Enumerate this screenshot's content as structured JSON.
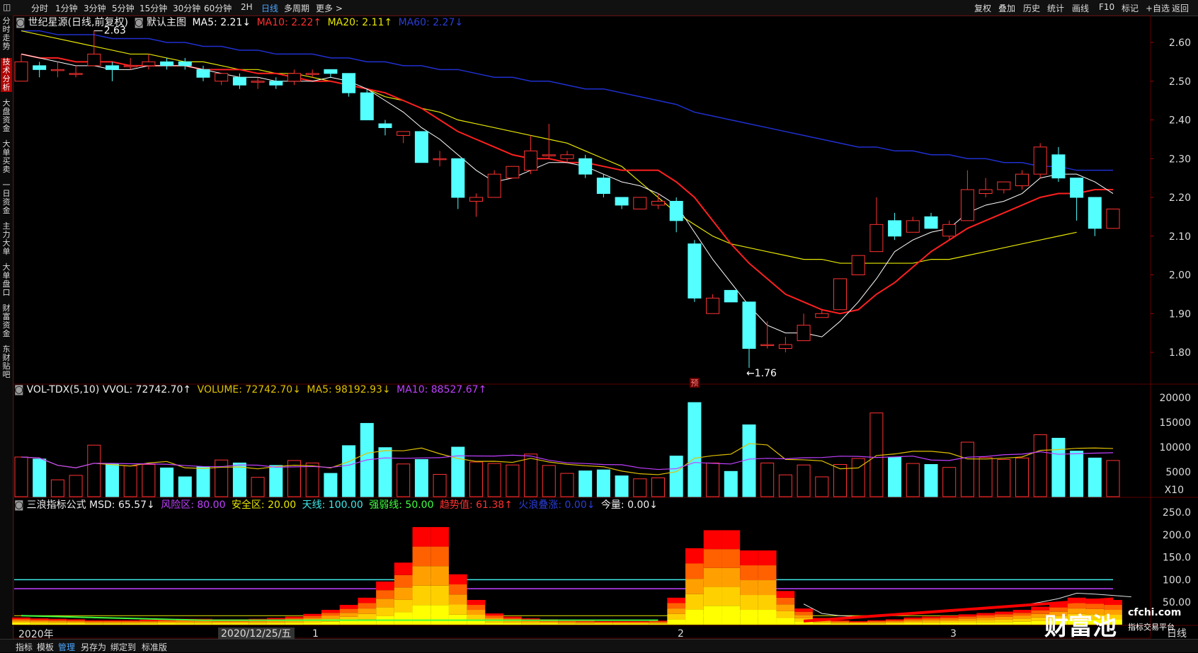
{
  "topbar": {
    "left_tabs": [
      "分时",
      "1分钟",
      "3分钟",
      "5分钟",
      "15分钟",
      "30分钟",
      "60分钟",
      "2H",
      "日线",
      "多周期",
      "更多 >"
    ],
    "active_tab": 8,
    "right_tabs": [
      "复权",
      "叠加",
      "历史",
      "统计",
      "画线",
      "F10",
      "标记",
      "+自选",
      "返回"
    ]
  },
  "sidebar": {
    "items": [
      "分时走势",
      "技术分析",
      "大盘资金",
      "大单买卖",
      "一日资金",
      "主力大单",
      "大单盘口",
      "财富资金",
      "东财贴吧"
    ],
    "active": 1
  },
  "main_legend": {
    "stock": "世纪星源(日线,前复权)",
    "chart_name": "默认主图",
    "ma5": "MA5: 2.21↓",
    "ma10": "MA10: 2.22↑",
    "ma20": "MA20: 2.11↑",
    "ma60": "MA60: 2.27↓"
  },
  "vol_legend": {
    "name": "VOL-TDX(5,10) VVOL: 72742.70↑",
    "volume": "VOLUME: 72742.70↓",
    "ma5": "MA5: 98192.93↓",
    "ma10": "MA10: 88527.67↑"
  },
  "ind_legend": {
    "name": "三浪指标公式 MSD: 65.57↓",
    "risk": "风险区: 80.00",
    "safe": "安全区: 20.00",
    "sky": "天线: 100.00",
    "strong": "强弱线: 50.00",
    "trend": "趋势值: 61.38↑",
    "wave": "火浪叠涨: 0.00↓",
    "today": "今量: 0.00↓"
  },
  "annotations": {
    "high": "2.63",
    "low": "←1.76",
    "forecast": "预"
  },
  "price_axis": [
    "2.60",
    "2.50",
    "2.40",
    "2.30",
    "2.20",
    "2.10",
    "2.00",
    "1.90",
    "1.80"
  ],
  "vol_axis": [
    "20000",
    "15000",
    "10000",
    "5000",
    "X10"
  ],
  "ind_axis": [
    "250.0",
    "200.0",
    "150.0",
    "100.0",
    "50.00"
  ],
  "date_axis": {
    "year": "2020年",
    "date": "2020/12/25/五",
    "months": [
      "1",
      "2",
      "3"
    ],
    "period": "日线"
  },
  "bottombar": {
    "items": [
      "指标",
      "模板",
      "管理",
      "另存为",
      "绑定到",
      "标准版"
    ],
    "active": 2
  },
  "watermark": {
    "brand": "财富池",
    "site": "cfchi.com",
    "tagline": "指标交易平台"
  },
  "colors": {
    "up": "#ff3232",
    "down": "#54ffff",
    "ma5": "#ffffff",
    "ma10": "#ff2020",
    "ma20": "#e8e800",
    "ma60": "#2030d0",
    "vol_ma5": "#e0c000",
    "vol_ma10": "#c040ff"
  },
  "chart_data": {
    "type": "candlestick",
    "price_range": [
      1.76,
      2.63
    ],
    "candles": [
      {
        "o": 2.5,
        "h": 2.57,
        "l": 2.5,
        "c": 2.55
      },
      {
        "o": 2.54,
        "h": 2.55,
        "l": 2.51,
        "c": 2.53
      },
      {
        "o": 2.53,
        "h": 2.55,
        "l": 2.51,
        "c": 2.53
      },
      {
        "o": 2.52,
        "h": 2.54,
        "l": 2.51,
        "c": 2.52
      },
      {
        "o": 2.54,
        "h": 2.63,
        "l": 2.54,
        "c": 2.57
      },
      {
        "o": 2.54,
        "h": 2.55,
        "l": 2.5,
        "c": 2.53
      },
      {
        "o": 2.54,
        "h": 2.56,
        "l": 2.53,
        "c": 2.54
      },
      {
        "o": 2.54,
        "h": 2.57,
        "l": 2.53,
        "c": 2.55
      },
      {
        "o": 2.55,
        "h": 2.56,
        "l": 2.53,
        "c": 2.54
      },
      {
        "o": 2.55,
        "h": 2.56,
        "l": 2.53,
        "c": 2.54
      },
      {
        "o": 2.53,
        "h": 2.54,
        "l": 2.5,
        "c": 2.51
      },
      {
        "o": 2.5,
        "h": 2.52,
        "l": 2.49,
        "c": 2.52
      },
      {
        "o": 2.51,
        "h": 2.52,
        "l": 2.48,
        "c": 2.49
      },
      {
        "o": 2.5,
        "h": 2.51,
        "l": 2.48,
        "c": 2.5
      },
      {
        "o": 2.5,
        "h": 2.51,
        "l": 2.48,
        "c": 2.49
      },
      {
        "o": 2.5,
        "h": 2.53,
        "l": 2.49,
        "c": 2.52
      },
      {
        "o": 2.52,
        "h": 2.53,
        "l": 2.51,
        "c": 2.52
      },
      {
        "o": 2.53,
        "h": 2.53,
        "l": 2.51,
        "c": 2.52
      },
      {
        "o": 2.52,
        "h": 2.52,
        "l": 2.46,
        "c": 2.47
      },
      {
        "o": 2.47,
        "h": 2.48,
        "l": 2.4,
        "c": 2.4
      },
      {
        "o": 2.39,
        "h": 2.4,
        "l": 2.36,
        "c": 2.38
      },
      {
        "o": 2.36,
        "h": 2.37,
        "l": 2.34,
        "c": 2.37
      },
      {
        "o": 2.37,
        "h": 2.37,
        "l": 2.29,
        "c": 2.29
      },
      {
        "o": 2.3,
        "h": 2.32,
        "l": 2.28,
        "c": 2.3
      },
      {
        "o": 2.3,
        "h": 2.3,
        "l": 2.17,
        "c": 2.2
      },
      {
        "o": 2.19,
        "h": 2.21,
        "l": 2.15,
        "c": 2.2
      },
      {
        "o": 2.2,
        "h": 2.27,
        "l": 2.2,
        "c": 2.26
      },
      {
        "o": 2.25,
        "h": 2.28,
        "l": 2.25,
        "c": 2.28
      },
      {
        "o": 2.27,
        "h": 2.36,
        "l": 2.26,
        "c": 2.32
      },
      {
        "o": 2.31,
        "h": 2.39,
        "l": 2.3,
        "c": 2.31
      },
      {
        "o": 2.3,
        "h": 2.32,
        "l": 2.29,
        "c": 2.31
      },
      {
        "o": 2.3,
        "h": 2.31,
        "l": 2.25,
        "c": 2.26
      },
      {
        "o": 2.25,
        "h": 2.26,
        "l": 2.2,
        "c": 2.21
      },
      {
        "o": 2.2,
        "h": 2.2,
        "l": 2.17,
        "c": 2.18
      },
      {
        "o": 2.17,
        "h": 2.2,
        "l": 2.17,
        "c": 2.2
      },
      {
        "o": 2.18,
        "h": 2.21,
        "l": 2.17,
        "c": 2.19
      },
      {
        "o": 2.19,
        "h": 2.2,
        "l": 2.11,
        "c": 2.14
      },
      {
        "o": 2.08,
        "h": 2.09,
        "l": 1.93,
        "c": 1.94
      },
      {
        "o": 1.9,
        "h": 1.95,
        "l": 1.9,
        "c": 1.94
      },
      {
        "o": 1.96,
        "h": 1.96,
        "l": 1.93,
        "c": 1.93
      },
      {
        "o": 1.93,
        "h": 1.93,
        "l": 1.76,
        "c": 1.81
      },
      {
        "o": 1.82,
        "h": 1.88,
        "l": 1.81,
        "c": 1.82
      },
      {
        "o": 1.81,
        "h": 1.84,
        "l": 1.8,
        "c": 1.82
      },
      {
        "o": 1.83,
        "h": 1.9,
        "l": 1.83,
        "c": 1.87
      },
      {
        "o": 1.89,
        "h": 1.91,
        "l": 1.89,
        "c": 1.9
      },
      {
        "o": 1.91,
        "h": 1.99,
        "l": 1.91,
        "c": 1.99
      },
      {
        "o": 2.0,
        "h": 2.05,
        "l": 2.0,
        "c": 2.05
      },
      {
        "o": 2.06,
        "h": 2.2,
        "l": 2.06,
        "c": 2.13
      },
      {
        "o": 2.14,
        "h": 2.16,
        "l": 2.09,
        "c": 2.1
      },
      {
        "o": 2.11,
        "h": 2.15,
        "l": 2.11,
        "c": 2.14
      },
      {
        "o": 2.15,
        "h": 2.16,
        "l": 2.12,
        "c": 2.12
      },
      {
        "o": 2.1,
        "h": 2.14,
        "l": 2.09,
        "c": 2.13
      },
      {
        "o": 2.14,
        "h": 2.27,
        "l": 2.14,
        "c": 2.22
      },
      {
        "o": 2.21,
        "h": 2.25,
        "l": 2.2,
        "c": 2.22
      },
      {
        "o": 2.22,
        "h": 2.24,
        "l": 2.21,
        "c": 2.24
      },
      {
        "o": 2.23,
        "h": 2.27,
        "l": 2.22,
        "c": 2.26
      },
      {
        "o": 2.26,
        "h": 2.34,
        "l": 2.25,
        "c": 2.33
      },
      {
        "o": 2.31,
        "h": 2.33,
        "l": 2.24,
        "c": 2.25
      },
      {
        "o": 2.25,
        "h": 2.25,
        "l": 2.14,
        "c": 2.2
      },
      {
        "o": 2.2,
        "h": 2.2,
        "l": 2.1,
        "c": 2.12
      },
      {
        "o": 2.12,
        "h": 2.17,
        "l": 2.12,
        "c": 2.17
      }
    ],
    "volume": [
      8000,
      7600,
      3400,
      4300,
      10400,
      6600,
      6200,
      6500,
      5800,
      4000,
      6000,
      7400,
      6800,
      3900,
      6300,
      7300,
      6800,
      4700,
      10300,
      14800,
      9900,
      6600,
      7500,
      4500,
      10000,
      7000,
      6700,
      6400,
      8600,
      6300,
      4700,
      5200,
      5400,
      4200,
      3600,
      3800,
      8200,
      19000,
      6800,
      5100,
      14500,
      6800,
      4400,
      6400,
      4000,
      6500,
      7700,
      16900,
      8000,
      6700,
      6500,
      5900,
      11000,
      7900,
      7500,
      7800,
      12500,
      11800,
      9200,
      7800,
      7300
    ],
    "msd_series": [
      16,
      14,
      13,
      12,
      10,
      10,
      10,
      11,
      12,
      13,
      13,
      12,
      12,
      13,
      15,
      18,
      24,
      33,
      44,
      60,
      96,
      138,
      217,
      217,
      112,
      55,
      25,
      18,
      14,
      12,
      10,
      9,
      8,
      8,
      8,
      9,
      60,
      170,
      210,
      210,
      165,
      165,
      75,
      36,
      15,
      10,
      8,
      10,
      12,
      16,
      18,
      20,
      23,
      26,
      29,
      33,
      40,
      48,
      60,
      58,
      55,
      52
    ],
    "ma5": [
      2.57,
      2.56,
      2.55,
      2.54,
      2.54,
      2.53,
      2.53,
      2.54,
      2.54,
      2.54,
      2.53,
      2.52,
      2.51,
      2.51,
      2.5,
      2.5,
      2.5,
      2.51,
      2.5,
      2.48,
      2.45,
      2.42,
      2.38,
      2.35,
      2.31,
      2.27,
      2.24,
      2.25,
      2.27,
      2.29,
      2.29,
      2.28,
      2.26,
      2.24,
      2.23,
      2.21,
      2.18,
      2.11,
      2.04,
      1.98,
      1.92,
      1.87,
      1.85,
      1.85,
      1.84,
      1.88,
      1.93,
      1.99,
      2.06,
      2.09,
      2.11,
      2.12,
      2.16,
      2.18,
      2.19,
      2.21,
      2.25,
      2.26,
      2.26,
      2.24,
      2.21
    ],
    "ma10": [
      2.57,
      2.56,
      2.56,
      2.55,
      2.55,
      2.55,
      2.54,
      2.54,
      2.54,
      2.54,
      2.53,
      2.53,
      2.53,
      2.52,
      2.52,
      2.51,
      2.5,
      2.5,
      2.49,
      2.48,
      2.47,
      2.45,
      2.43,
      2.4,
      2.37,
      2.35,
      2.33,
      2.31,
      2.3,
      2.3,
      2.29,
      2.29,
      2.28,
      2.27,
      2.27,
      2.27,
      2.24,
      2.2,
      2.14,
      2.08,
      2.03,
      1.99,
      1.95,
      1.93,
      1.91,
      1.9,
      1.91,
      1.95,
      1.98,
      2.02,
      2.06,
      2.09,
      2.12,
      2.14,
      2.16,
      2.18,
      2.2,
      2.21,
      2.21,
      2.22,
      2.22
    ],
    "ma20": [
      2.63,
      2.62,
      2.61,
      2.6,
      2.59,
      2.58,
      2.57,
      2.57,
      2.56,
      2.55,
      2.55,
      2.54,
      2.53,
      2.53,
      2.52,
      2.52,
      2.51,
      2.5,
      2.49,
      2.48,
      2.46,
      2.45,
      2.43,
      2.42,
      2.4,
      2.39,
      2.38,
      2.37,
      2.36,
      2.35,
      2.34,
      2.32,
      2.3,
      2.28,
      2.24,
      2.2,
      2.16,
      2.13,
      2.1,
      2.08,
      2.07,
      2.06,
      2.05,
      2.04,
      2.04,
      2.03,
      2.03,
      2.03,
      2.03,
      2.03,
      2.04,
      2.04,
      2.05,
      2.06,
      2.07,
      2.08,
      2.09,
      2.1,
      2.11
    ],
    "ma60": [
      2.63,
      2.63,
      2.62,
      2.62,
      2.62,
      2.61,
      2.61,
      2.61,
      2.6,
      2.6,
      2.59,
      2.59,
      2.58,
      2.58,
      2.57,
      2.57,
      2.57,
      2.56,
      2.56,
      2.55,
      2.55,
      2.54,
      2.54,
      2.53,
      2.53,
      2.52,
      2.51,
      2.51,
      2.5,
      2.5,
      2.49,
      2.48,
      2.48,
      2.47,
      2.46,
      2.45,
      2.44,
      2.42,
      2.41,
      2.4,
      2.39,
      2.38,
      2.37,
      2.36,
      2.35,
      2.34,
      2.33,
      2.33,
      2.32,
      2.32,
      2.31,
      2.31,
      2.3,
      2.3,
      2.29,
      2.29,
      2.28,
      2.28,
      2.27,
      2.27,
      2.27
    ]
  }
}
